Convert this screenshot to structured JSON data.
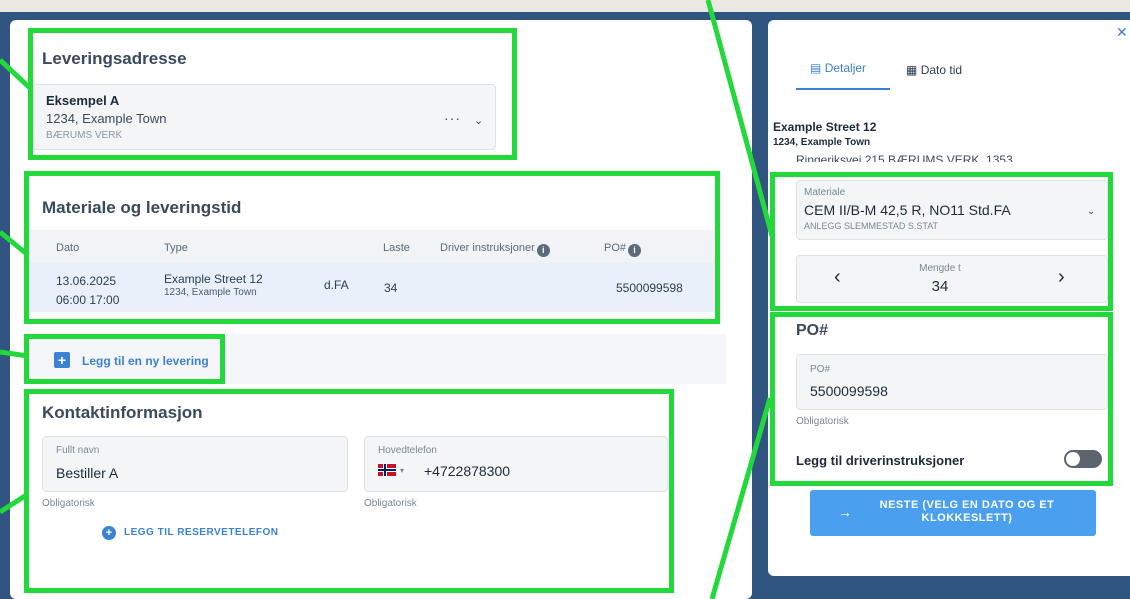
{
  "delivery_address": {
    "title": "Leveringsadresse",
    "name": "Eksempel A",
    "line": "1234, Example Town",
    "hidden_line": "BÆRUMS VERK",
    "more": "···"
  },
  "material_section": {
    "title": "Materiale og leveringstid",
    "columns": [
      "Dato",
      "Type",
      "Laste",
      "Driver instruksjoner",
      "PO#"
    ],
    "row": {
      "date": "13.06.2025",
      "time": "06:00 17:00",
      "type_title": "Example Street 12",
      "type_sub": "1234, Example Town",
      "type_suffix": "d.FA",
      "load": "34",
      "po": "5500099598"
    }
  },
  "add_delivery": {
    "label": "Legg til en ny levering"
  },
  "contact": {
    "title": "Kontaktinformasjon",
    "name_label": "Fullt navn",
    "name_value": "Bestiller A",
    "name_hint": "Obligatorisk",
    "phone_label": "Hovedtelefon",
    "phone_value": "+4722878300",
    "phone_hint": "Obligatorisk",
    "backup_phone": "LEGG TIL RESERVETELEFON"
  },
  "drawer": {
    "tab_details": "Detaljer",
    "tab_date": "Dato tid",
    "address_title": "Example Street 12",
    "address_sub": "1234, Example Town",
    "address_hidden": "Ringeriksvei 215 BÆRUMS VERK, 1353",
    "material_label": "Materiale",
    "material_value": "CEM II/B-M 42,5 R, NO11 Std.FA",
    "material_sub": "ANLEGG SLEMMESTAD S.STAT",
    "qty_label": "Mengde t",
    "qty_value": "34",
    "po_title": "PO#",
    "po_label": "PO#",
    "po_value": "5500099598",
    "po_hint": "Obligatorisk",
    "driver_toggle_label": "Legg til driverinstruksjoner",
    "next_button": "NESTE (VELG EN DATO OG ET KLOKKESLETT)"
  },
  "colors": {
    "accent": "#3b82d4",
    "annotation": "#22d83a",
    "background": "#2f5580"
  }
}
